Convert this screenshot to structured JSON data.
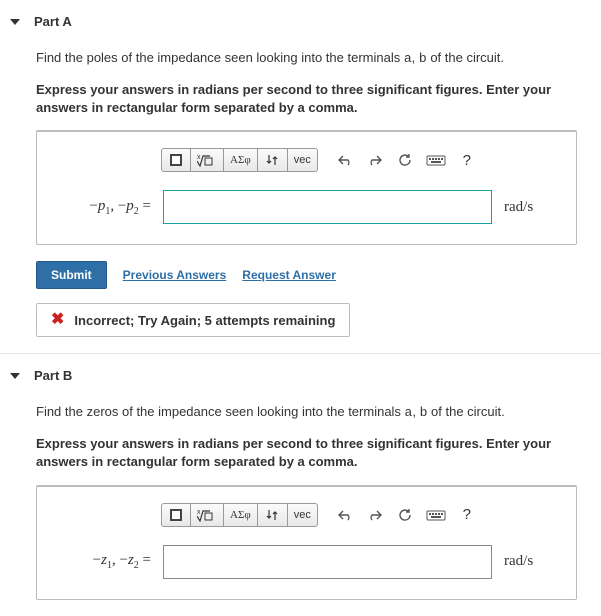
{
  "partA": {
    "title": "Part A",
    "prompt_before": "Find the poles of the impedance seen looking into the terminals ",
    "term_a": "a",
    "term_comma": ", ",
    "term_b": "b",
    "prompt_after": " of the circuit.",
    "rule": "Express your answers in radians per second to three significant figures. Enter your answers in rectangular form separated by a comma.",
    "lhs_html": "−p₁, −p₂ =",
    "units": "rad/s",
    "submit": "Submit",
    "prev_link": "Previous Answers",
    "req_link": "Request Answer",
    "feedback": "Incorrect; Try Again; 5 attempts remaining"
  },
  "partB": {
    "title": "Part B",
    "prompt_before": "Find the zeros of the impedance seen looking into the terminals ",
    "term_a": "a",
    "term_comma": ", ",
    "term_b": "b",
    "prompt_after": " of the circuit.",
    "rule": "Express your answers in radians per second to three significant figures. Enter your answers in rectangular form separated by a comma.",
    "lhs_html": "−z₁, −z₂ =",
    "units": "rad/s"
  },
  "toolbar": {
    "template": "template",
    "fraction": "x√",
    "greek": "ΑΣφ",
    "subscript": "↓↑",
    "vec": "vec",
    "undo": "↶",
    "redo": "↷",
    "reset": "↻",
    "keyboard": "⌨",
    "help": "?"
  }
}
